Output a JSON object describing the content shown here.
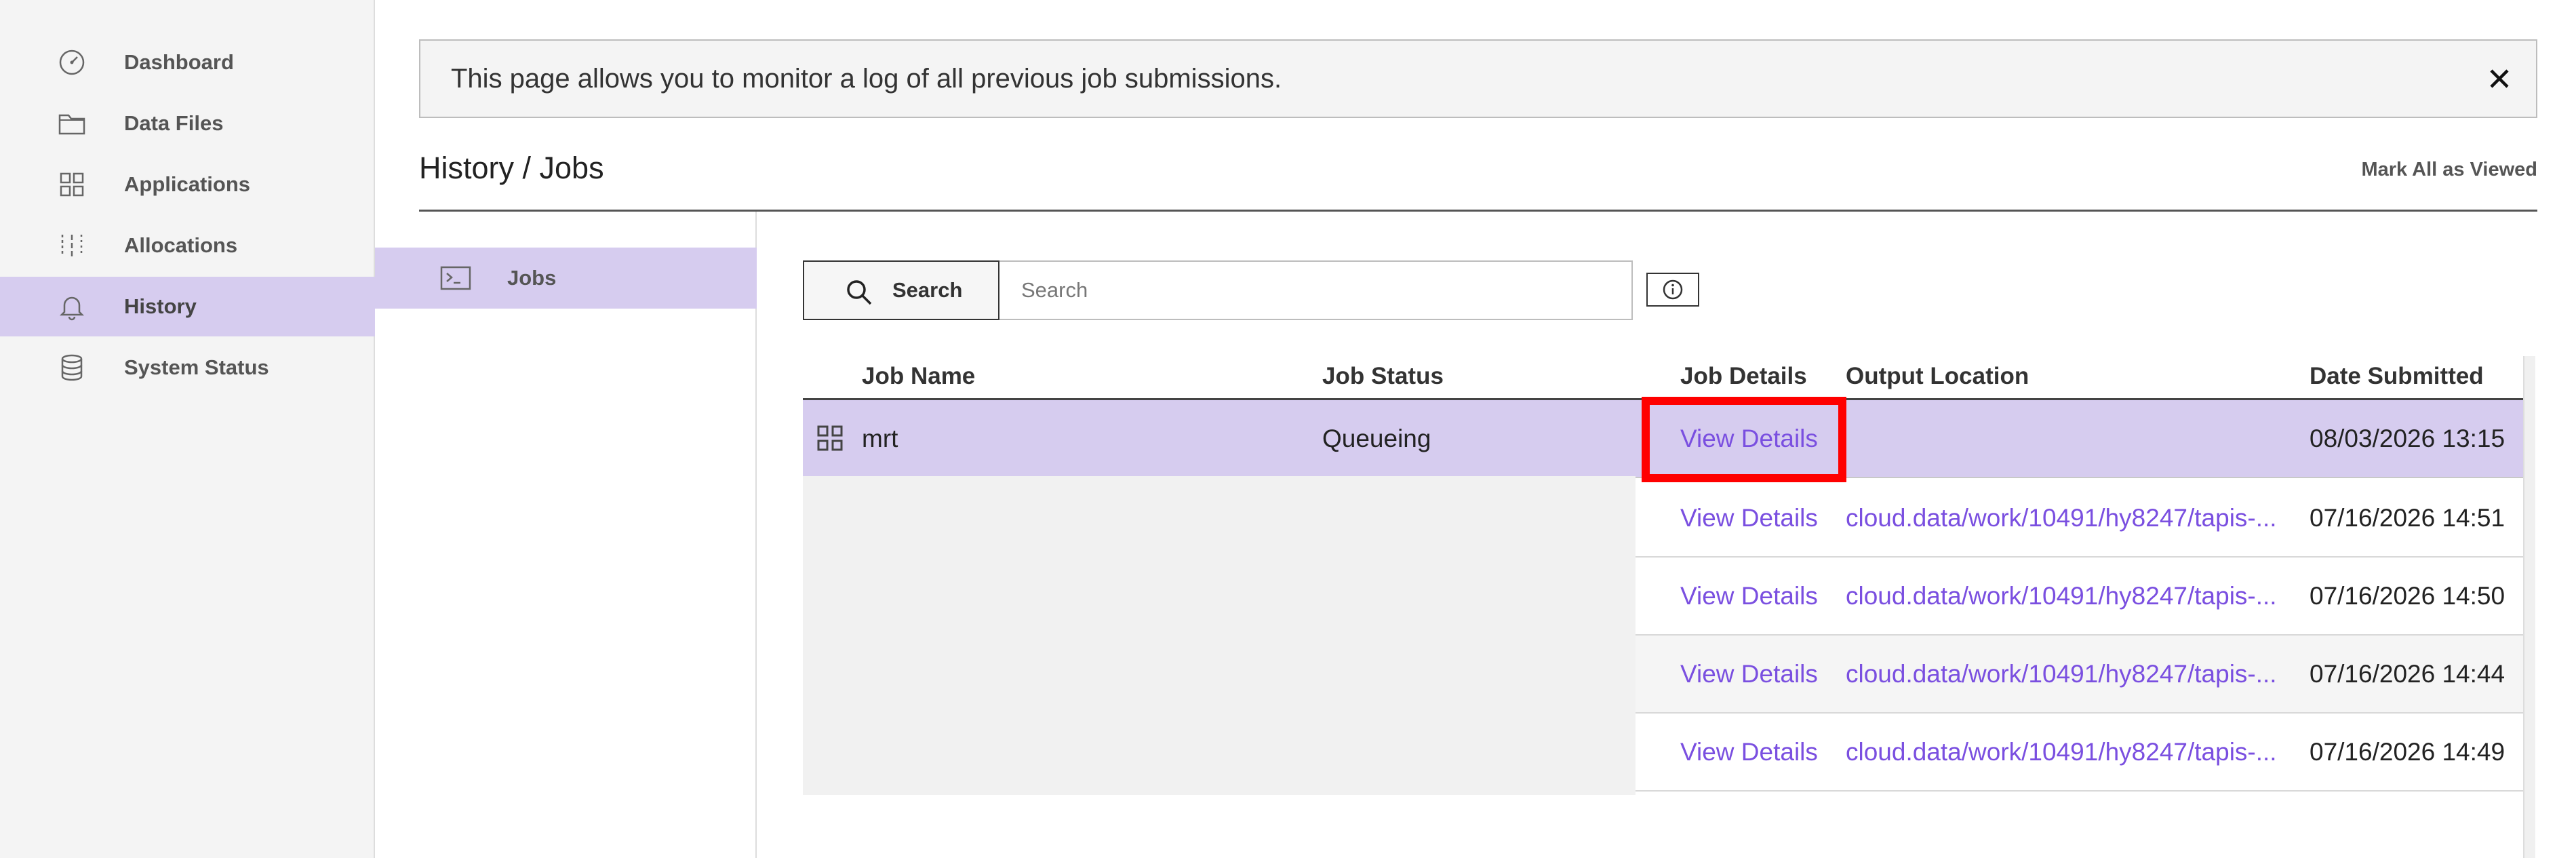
{
  "sidebar": {
    "items": [
      {
        "label": "Dashboard",
        "icon": "gauge-icon"
      },
      {
        "label": "Data Files",
        "icon": "folder-icon"
      },
      {
        "label": "Applications",
        "icon": "grid-icon"
      },
      {
        "label": "Allocations",
        "icon": "sliders-icon"
      },
      {
        "label": "History",
        "icon": "bell-icon",
        "active": true
      },
      {
        "label": "System Status",
        "icon": "database-icon"
      }
    ]
  },
  "notice": {
    "text": "This page allows you to monitor a log of all previous job submissions.",
    "close_icon": "close-icon"
  },
  "header": {
    "breadcrumb": "History / Jobs",
    "mark_all_label": "Mark All as Viewed"
  },
  "subnav": {
    "items": [
      {
        "label": "Jobs",
        "icon": "terminal-icon",
        "active": true
      }
    ]
  },
  "search": {
    "button_label": "Search",
    "placeholder": "Search",
    "value": "",
    "info_icon": "info-icon"
  },
  "table": {
    "columns": [
      "Job Name",
      "Job Status",
      "Job Details",
      "Output Location",
      "Date Submitted"
    ],
    "rows": [
      {
        "job_name": "mrt",
        "job_status": "Queueing",
        "details": "View Details",
        "output": "",
        "date": "08/03/2026 13:15",
        "app_icon": "grid-icon",
        "selected": true
      },
      {
        "job_name": "",
        "job_status": "",
        "details": "View Details",
        "output": "cloud.data/work/10491/hy8247/tapis-...",
        "date": "07/16/2026 14:51"
      },
      {
        "job_name": "",
        "job_status": "",
        "details": "View Details",
        "output": "cloud.data/work/10491/hy8247/tapis-...",
        "date": "07/16/2026 14:50"
      },
      {
        "job_name": "",
        "job_status": "",
        "details": "View Details",
        "output": "cloud.data/work/10491/hy8247/tapis-...",
        "date": "07/16/2026 14:44"
      },
      {
        "job_name": "",
        "job_status": "",
        "details": "View Details",
        "output": "cloud.data/work/10491/hy8247/tapis-...",
        "date": "07/16/2026 14:49"
      }
    ]
  },
  "colors": {
    "accent": "#7a4fe0",
    "selected_bg": "#d6ccef",
    "highlight": "#ff0000"
  }
}
